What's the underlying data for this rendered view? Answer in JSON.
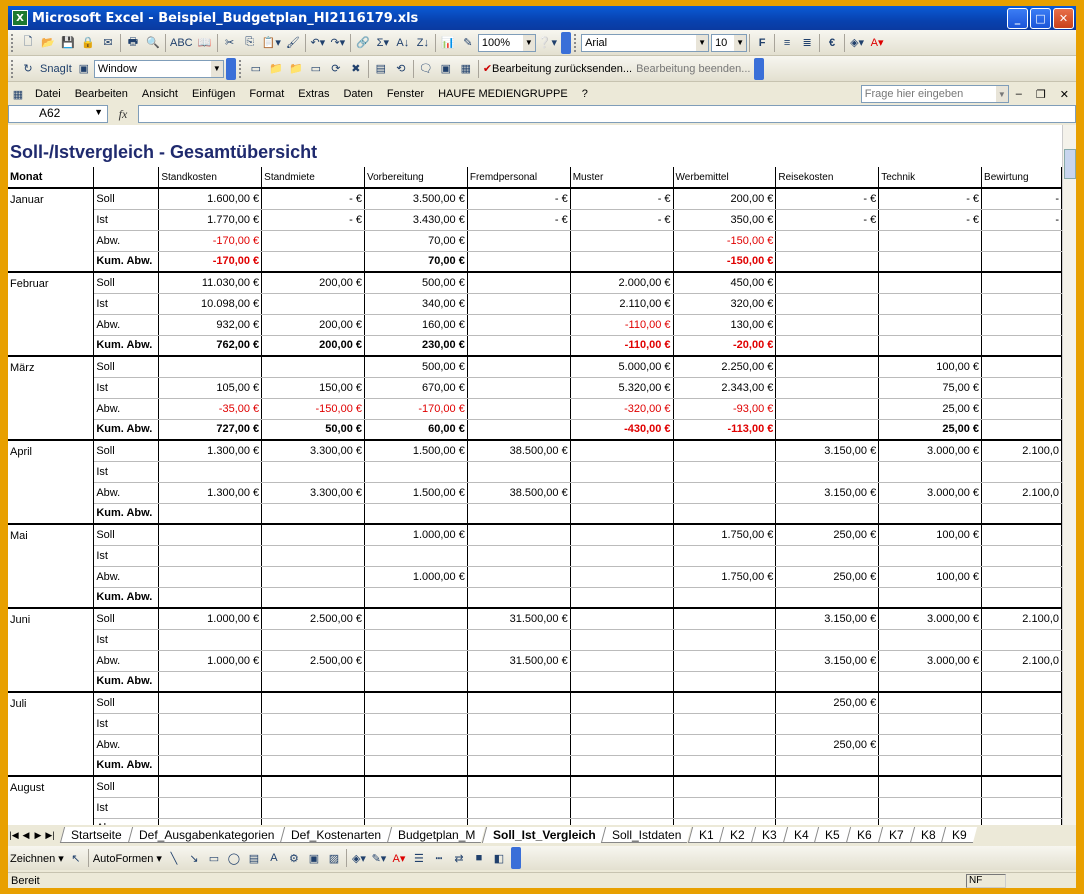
{
  "window": {
    "title": "Microsoft Excel - Beispiel_Budgetplan_HI2116179.xls",
    "app_icon": "X"
  },
  "toolbar1": {
    "zoom": "100%",
    "font": "Arial",
    "size": "10",
    "bold": "F"
  },
  "toolbar2": {
    "snagit": "SnagIt",
    "window_combo": "Window",
    "review_back": "Bearbeitung zurücksenden...",
    "review_end": "Bearbeitung beenden..."
  },
  "menu": [
    "Datei",
    "Bearbeiten",
    "Ansicht",
    "Einfügen",
    "Format",
    "Extras",
    "Daten",
    "Fenster",
    "HAUFE MEDIENGRUPPE",
    "?"
  ],
  "help_placeholder": "Frage hier eingeben",
  "formula": {
    "namebox": "A62",
    "fx": "fx"
  },
  "sheet_title": "Soll-/Istvergleich - Gesamtübersicht",
  "headers": [
    "Monat",
    "",
    "Standkosten",
    "Standmiete",
    "Vorbereitung",
    "Fremdpersonal",
    "Muster",
    "Werbemittel",
    "Reisekosten",
    "Technik",
    "Bewirtung"
  ],
  "months": [
    {
      "name": "Januar",
      "rows": [
        [
          "Soll",
          "1.600,00 €",
          "-      €",
          "3.500,00 €",
          "-      €",
          "-      €",
          "200,00 €",
          "-      €",
          "-      €",
          "-"
        ],
        [
          "Ist",
          "1.770,00 €",
          "-      €",
          "3.430,00 €",
          "-      €",
          "-      €",
          "350,00 €",
          "-      €",
          "-      €",
          "-"
        ],
        [
          "Abw.",
          "-170,00 €",
          "",
          "70,00 €",
          "",
          "",
          "-150,00 €",
          "",
          "",
          ""
        ],
        [
          "Kum. Abw.",
          "-170,00 €",
          "",
          "70,00 €",
          "",
          "",
          "-150,00 €",
          "",
          "",
          ""
        ]
      ]
    },
    {
      "name": "Februar",
      "rows": [
        [
          "Soll",
          "11.030,00 €",
          "200,00 €",
          "500,00 €",
          "",
          "2.000,00 €",
          "450,00 €",
          "",
          "",
          ""
        ],
        [
          "Ist",
          "10.098,00 €",
          "",
          "340,00 €",
          "",
          "2.110,00 €",
          "320,00 €",
          "",
          "",
          ""
        ],
        [
          "Abw.",
          "932,00 €",
          "200,00 €",
          "160,00 €",
          "",
          "-110,00 €",
          "130,00 €",
          "",
          "",
          ""
        ],
        [
          "Kum. Abw.",
          "762,00 €",
          "200,00 €",
          "230,00 €",
          "",
          "-110,00 €",
          "-20,00 €",
          "",
          "",
          ""
        ]
      ]
    },
    {
      "name": "März",
      "rows": [
        [
          "Soll",
          "",
          "",
          "500,00 €",
          "",
          "5.000,00 €",
          "2.250,00 €",
          "",
          "100,00 €",
          ""
        ],
        [
          "Ist",
          "105,00 €",
          "150,00 €",
          "670,00 €",
          "",
          "5.320,00 €",
          "2.343,00 €",
          "",
          "75,00 €",
          ""
        ],
        [
          "Abw.",
          "-35,00 €",
          "-150,00 €",
          "-170,00 €",
          "",
          "-320,00 €",
          "-93,00 €",
          "",
          "25,00 €",
          ""
        ],
        [
          "Kum. Abw.",
          "727,00 €",
          "50,00 €",
          "60,00 €",
          "",
          "-430,00 €",
          "-113,00 €",
          "",
          "25,00 €",
          ""
        ]
      ]
    },
    {
      "name": "April",
      "rows": [
        [
          "Soll",
          "1.300,00 €",
          "3.300,00 €",
          "1.500,00 €",
          "38.500,00 €",
          "",
          "",
          "3.150,00 €",
          "3.000,00 €",
          "2.100,0"
        ],
        [
          "Ist",
          "",
          "",
          "",
          "",
          "",
          "",
          "",
          "",
          ""
        ],
        [
          "Abw.",
          "1.300,00 €",
          "3.300,00 €",
          "1.500,00 €",
          "38.500,00 €",
          "",
          "",
          "3.150,00 €",
          "3.000,00 €",
          "2.100,0"
        ],
        [
          "Kum. Abw.",
          "",
          "",
          "",
          "",
          "",
          "",
          "",
          "",
          ""
        ]
      ]
    },
    {
      "name": "Mai",
      "rows": [
        [
          "Soll",
          "",
          "",
          "1.000,00 €",
          "",
          "",
          "1.750,00 €",
          "250,00 €",
          "100,00 €",
          ""
        ],
        [
          "Ist",
          "",
          "",
          "",
          "",
          "",
          "",
          "",
          "",
          ""
        ],
        [
          "Abw.",
          "",
          "",
          "1.000,00 €",
          "",
          "",
          "1.750,00 €",
          "250,00 €",
          "100,00 €",
          ""
        ],
        [
          "Kum. Abw.",
          "",
          "",
          "",
          "",
          "",
          "",
          "",
          "",
          ""
        ]
      ]
    },
    {
      "name": "Juni",
      "rows": [
        [
          "Soll",
          "1.000,00 €",
          "2.500,00 €",
          "",
          "31.500,00 €",
          "",
          "",
          "3.150,00 €",
          "3.000,00 €",
          "2.100,0"
        ],
        [
          "Ist",
          "",
          "",
          "",
          "",
          "",
          "",
          "",
          "",
          ""
        ],
        [
          "Abw.",
          "1.000,00 €",
          "2.500,00 €",
          "",
          "31.500,00 €",
          "",
          "",
          "3.150,00 €",
          "3.000,00 €",
          "2.100,0"
        ],
        [
          "Kum. Abw.",
          "",
          "",
          "",
          "",
          "",
          "",
          "",
          "",
          ""
        ]
      ]
    },
    {
      "name": "Juli",
      "rows": [
        [
          "Soll",
          "",
          "",
          "",
          "",
          "",
          "",
          "250,00 €",
          "",
          ""
        ],
        [
          "Ist",
          "",
          "",
          "",
          "",
          "",
          "",
          "",
          "",
          ""
        ],
        [
          "Abw.",
          "",
          "",
          "",
          "",
          "",
          "",
          "250,00 €",
          "",
          ""
        ],
        [
          "Kum. Abw.",
          "",
          "",
          "",
          "",
          "",
          "",
          "",
          "",
          ""
        ]
      ]
    },
    {
      "name": "August",
      "rows": [
        [
          "Soll",
          "",
          "",
          "",
          "",
          "",
          "",
          "",
          "",
          ""
        ],
        [
          "Ist",
          "",
          "",
          "",
          "",
          "",
          "",
          "",
          "",
          ""
        ],
        [
          "Abw.",
          "",
          "",
          "",
          "",
          "",
          "",
          "",
          "",
          ""
        ]
      ]
    }
  ],
  "sheet_tabs": [
    "Startseite",
    "Def_Ausgabenkategorien",
    "Def_Kostenarten",
    "Budgetplan_M",
    "Soll_Ist_Vergleich",
    "Soll_Istdaten",
    "K1",
    "K2",
    "K3",
    "K4",
    "K5",
    "K6",
    "K7",
    "K8",
    "K9"
  ],
  "active_tab": "Soll_Ist_Vergleich",
  "drawbar": {
    "zeichnen": "Zeichnen ▾",
    "autoformen": "AutoFormen ▾"
  },
  "status": {
    "left": "Bereit",
    "right": "NF"
  }
}
